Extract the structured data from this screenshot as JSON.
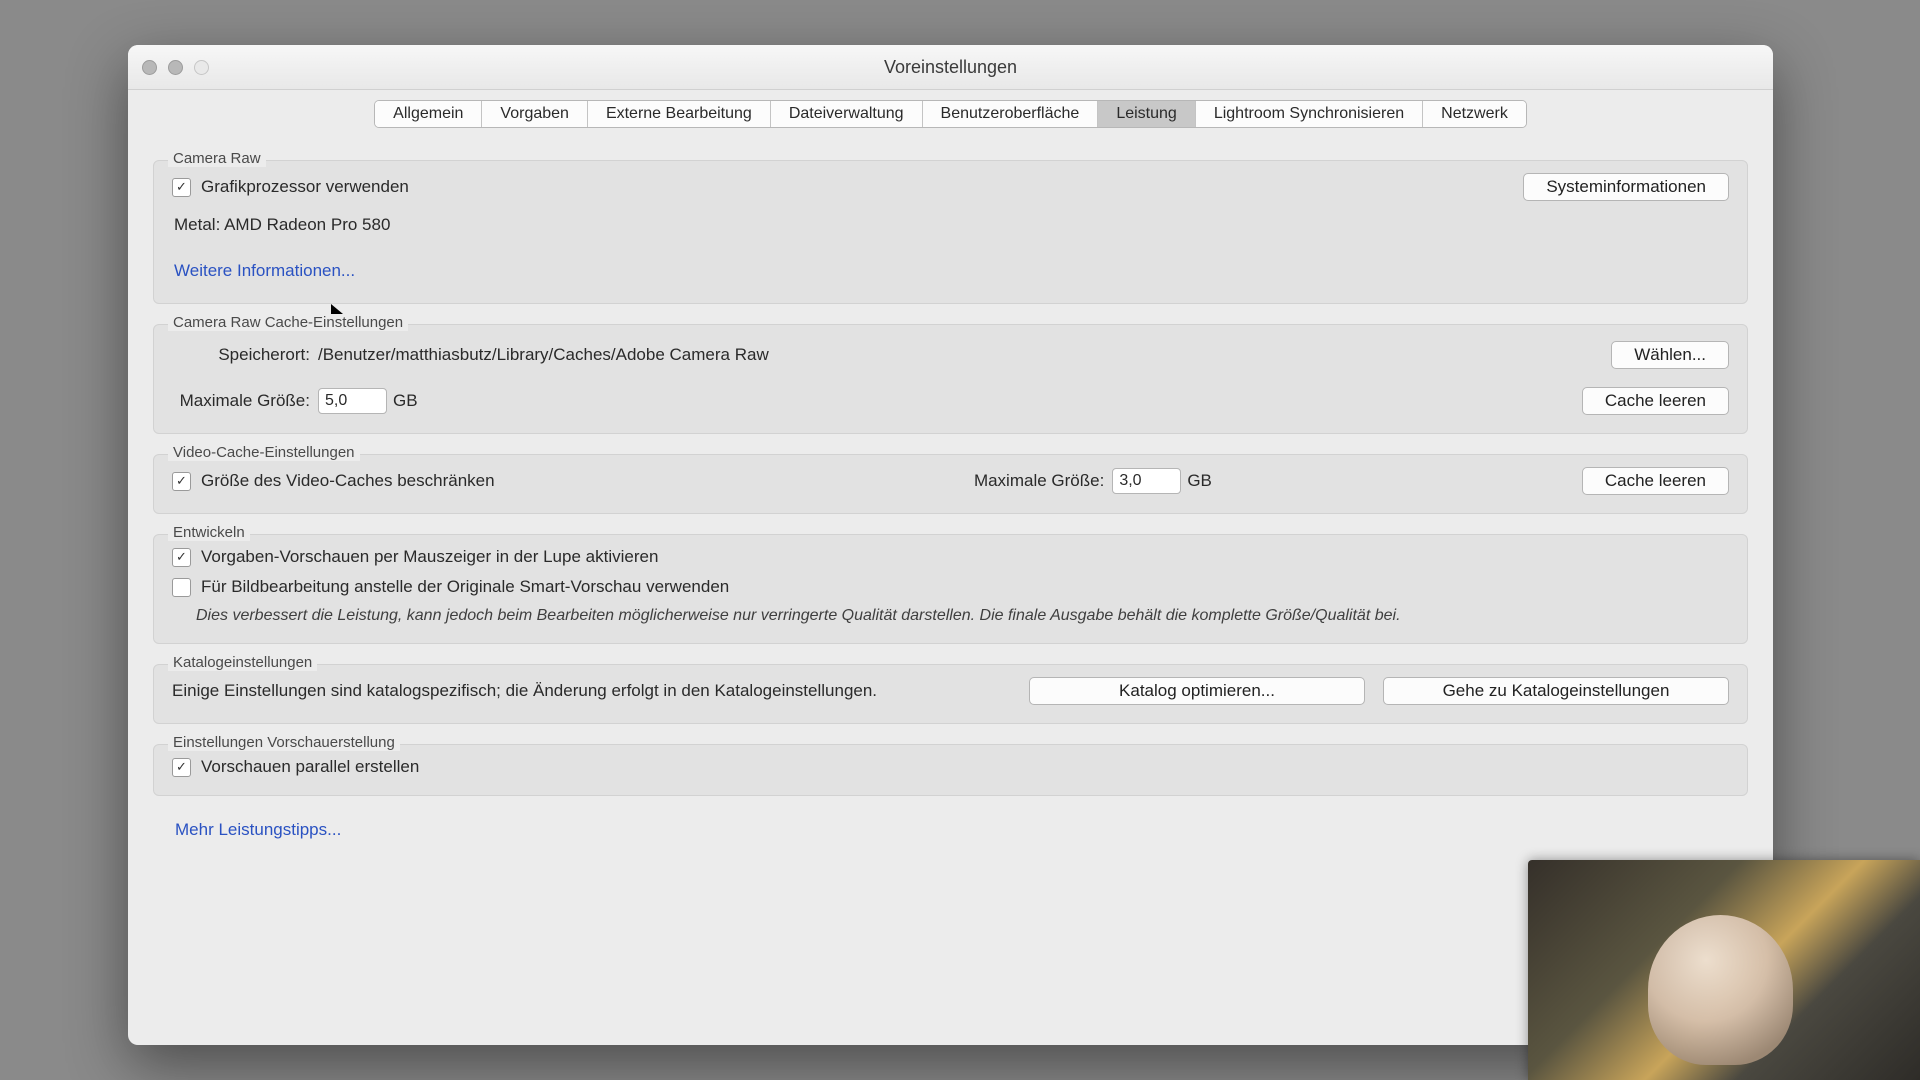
{
  "window_title": "Voreinstellungen",
  "tabs": [
    "Allgemein",
    "Vorgaben",
    "Externe Bearbeitung",
    "Dateiverwaltung",
    "Benutzeroberfläche",
    "Leistung",
    "Lightroom Synchronisieren",
    "Netzwerk"
  ],
  "selected_tab_index": 5,
  "camera_raw": {
    "title": "Camera Raw",
    "gpu_checkbox_label": "Grafikprozessor verwenden",
    "gpu_checked": true,
    "system_info_btn": "Systeminformationen",
    "gpu_line": "Metal: AMD Radeon Pro 580",
    "more_info_link": "Weitere Informationen..."
  },
  "cr_cache": {
    "title": "Camera Raw Cache-Einstellungen",
    "location_label": "Speicherort:",
    "location_value": "/Benutzer/matthiasbutz/Library/Caches/Adobe Camera Raw",
    "choose_btn": "Wählen...",
    "max_size_label": "Maximale Größe:",
    "max_size_value": "5,0",
    "unit": "GB",
    "purge_btn": "Cache leeren"
  },
  "video_cache": {
    "title": "Video-Cache-Einstellungen",
    "limit_label": "Größe des Video-Caches beschränken",
    "limit_checked": true,
    "max_size_label": "Maximale Größe:",
    "max_size_value": "3,0",
    "unit": "GB",
    "purge_btn": "Cache leeren"
  },
  "develop": {
    "title": "Entwickeln",
    "preset_hover_label": "Vorgaben-Vorschauen per Mauszeiger in der Lupe aktivieren",
    "preset_hover_checked": true,
    "smart_preview_label": "Für Bildbearbeitung anstelle der Originale Smart-Vorschau verwenden",
    "smart_preview_checked": false,
    "hint": "Dies verbessert die Leistung, kann jedoch beim Bearbeiten möglicherweise nur verringerte Qualität darstellen. Die finale Ausgabe behält die komplette Größe/Qualität bei."
  },
  "catalog": {
    "title": "Katalogeinstellungen",
    "text": "Einige Einstellungen sind katalogspezifisch; die Änderung erfolgt in den Katalogeinstellungen.",
    "optimize_btn": "Katalog optimieren...",
    "goto_btn": "Gehe zu Katalogeinstellungen"
  },
  "preview_gen": {
    "title": "Einstellungen Vorschauerstellung",
    "parallel_label": "Vorschauen parallel erstellen",
    "parallel_checked": true
  },
  "more_tips_link": "Mehr Leistungstipps..."
}
